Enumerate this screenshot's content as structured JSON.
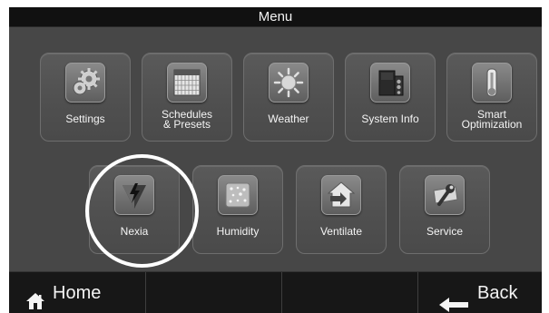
{
  "title": "Menu",
  "tiles": [
    {
      "label": "Settings",
      "icon": "gears-icon"
    },
    {
      "label_line1": "Schedules",
      "label_line2": "& Presets",
      "icon": "calendar-icon"
    },
    {
      "label": "Weather",
      "icon": "sun-icon"
    },
    {
      "label": "System Info",
      "icon": "hvac-unit-icon"
    },
    {
      "label_line1": "Smart",
      "label_line2": "Optimization",
      "icon": "thermometer-icon"
    },
    {
      "label": "Nexia",
      "icon": "nexia-logo-icon"
    },
    {
      "label": "Humidity",
      "icon": "humidity-icon"
    },
    {
      "label": "Ventilate",
      "icon": "ventilate-icon"
    },
    {
      "label": "Service",
      "icon": "wrench-icon"
    }
  ],
  "bottom_bar": {
    "home_label": "Home",
    "back_label": "Back"
  },
  "colors": {
    "background": "#474747",
    "title_bar": "#111111",
    "bottom_bar": "#171717",
    "tile": "#555555",
    "text": "#f4f4f4",
    "highlight_circle": "#ffffff"
  }
}
